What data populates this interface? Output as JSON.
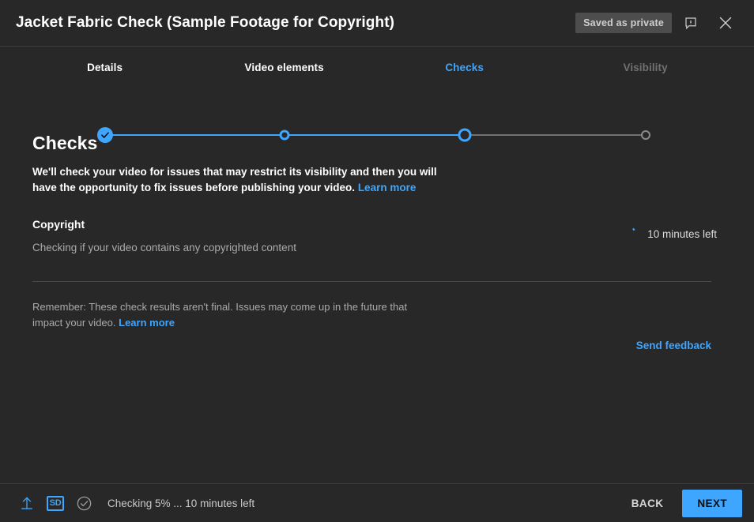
{
  "header": {
    "title": "Jacket Fabric Check (Sample Footage for Copyright)",
    "save_state": "Saved as private",
    "feedback_icon": "feedback-bubble-icon",
    "close_icon": "close-icon"
  },
  "stepper": {
    "steps": [
      {
        "label": "Details",
        "state": "complete",
        "x_pct": 13.9
      },
      {
        "label": "Video elements",
        "state": "visited",
        "x_pct": 37.7
      },
      {
        "label": "Checks",
        "state": "current",
        "x_pct": 61.6
      },
      {
        "label": "Visibility",
        "state": "inactive",
        "x_pct": 85.6
      }
    ]
  },
  "main": {
    "title": "Checks",
    "description_part1": "We'll check your video for issues that may restrict its visibility and then you will have the opportunity to fix issues before publishing your video.",
    "description_link": "Learn more",
    "check": {
      "name": "Copyright",
      "subtitle": "Checking if your video contains any copyrighted content",
      "status_icon": "loading-spinner-icon",
      "status_text": "10 minutes left"
    },
    "remember_part1": "Remember: These check results aren't final. Issues may come up in the future that impact your video.",
    "remember_link": "Learn more",
    "send_feedback": "Send feedback"
  },
  "footer": {
    "upload_icon": "upload-arrow-icon",
    "quality_badge": "SD",
    "checks_icon": "check-circle-icon",
    "status": "Checking 5% ... 10 minutes left",
    "back_label": "BACK",
    "next_label": "NEXT"
  },
  "colors": {
    "accent": "#3ea6ff",
    "background": "#282828",
    "divider": "#3d3d3d",
    "muted_text": "#aaaaaa",
    "inactive": "#717171"
  }
}
